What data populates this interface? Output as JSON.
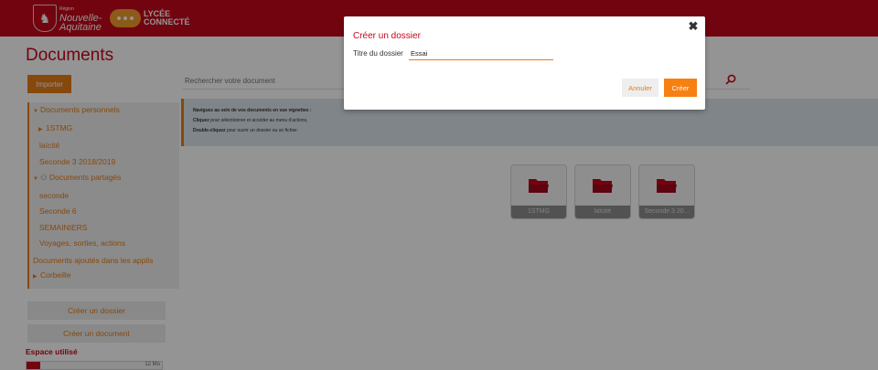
{
  "header": {
    "region_small": "Région",
    "region_name_line1": "Nouvelle-",
    "region_name_line2": "Aquitaine",
    "brand_line1": "LYCÉE",
    "brand_line2": "CONNECTÉ"
  },
  "sidebar": {
    "title": "Documents",
    "import_label": "Importer",
    "tree": [
      {
        "label": "Documents personnels",
        "level": 0,
        "arrow": "▼"
      },
      {
        "label": "1STMG",
        "level": 1,
        "arrow": "▶"
      },
      {
        "label": "laïcité",
        "level": 2,
        "arrow": ""
      },
      {
        "label": "Seconde 3 2018/2019",
        "level": 2,
        "arrow": ""
      },
      {
        "label": "Documents partagés",
        "level": 0,
        "arrow": "▼"
      },
      {
        "label": "seconde",
        "level": 2,
        "arrow": ""
      },
      {
        "label": "Seconde 6",
        "level": 2,
        "arrow": ""
      },
      {
        "label": "SEMAINIERS",
        "level": 2,
        "arrow": ""
      },
      {
        "label": "Voyages, sorties, actions",
        "level": 2,
        "arrow": ""
      },
      {
        "label": "Documents ajoutés dans les applis",
        "level": 0,
        "arrow": ""
      },
      {
        "label": "Corbeille",
        "level": 0,
        "arrow": "▶"
      }
    ],
    "create_folder_label": "Créer un dossier",
    "create_document_label": "Créer un document",
    "space_label": "Espace utilisé",
    "space_value": "12 Mo",
    "space_used_fraction": 0.1
  },
  "main": {
    "search_placeholder": "Rechercher votre document",
    "info_line1_bold": "Naviguez au sein de vos documents en vue vignettes :",
    "info_line2_bold": "Cliquez",
    "info_line2_rest": " pour sélectionner et accéder au menu d'actions,",
    "info_line3_bold": "Double-cliquez",
    "info_line3_rest": " pour ouvrir un dossier ou un fichier.",
    "folders": [
      "1STMG",
      "laïcité",
      "Seconde 3 20..."
    ]
  },
  "modal": {
    "title": "Créer un dossier",
    "close_glyph": "✖",
    "field_label": "Titre du dossier",
    "field_value": "Essai",
    "cancel_label": "Annuler",
    "create_label": "Créer"
  },
  "colors": {
    "brand_red": "#c4081b",
    "accent_orange": "#e87c15",
    "create_orange": "#f78012"
  }
}
